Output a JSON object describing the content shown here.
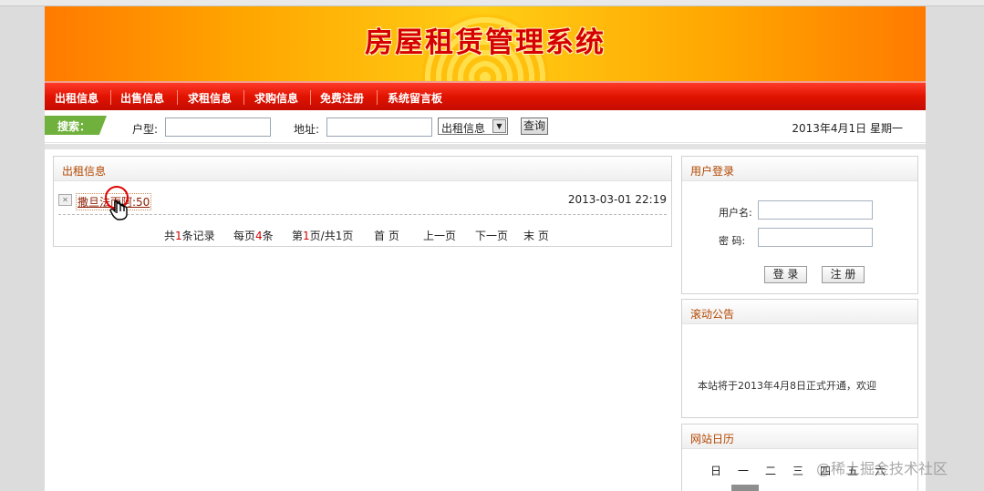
{
  "header": {
    "site_title": "房屋租赁管理系统"
  },
  "nav": {
    "items": [
      "出租信息",
      "出售信息",
      "求租信息",
      "求购信息",
      "免费注册",
      "系统留言板"
    ]
  },
  "search": {
    "tag": "搜索：",
    "type_label": "户型:",
    "type_value": "",
    "address_label": "地址:",
    "address_value": "",
    "category_selected": "出租信息",
    "query_button": "查询",
    "date": "2013年4月1日 星期一"
  },
  "listing": {
    "title": "出租信息",
    "rows": [
      {
        "label": "撒旦法而阿:50",
        "time": "2013-03-01 22:19"
      }
    ],
    "pager": {
      "total_prefix": "共",
      "total": "1",
      "total_suffix": "条记录",
      "per_page_prefix": "每页",
      "per_page": "4",
      "per_page_suffix": "条",
      "page_prefix": "第",
      "page": "1",
      "page_suffix": "页/共1页",
      "first": "首 页",
      "prev": "上一页",
      "next": "下一页",
      "last": "末 页"
    }
  },
  "login": {
    "title": "用户登录",
    "username_label": "用户名:",
    "password_label": "密 码:",
    "login_button": "登 录",
    "register_button": "注 册"
  },
  "notice": {
    "title": "滚动公告",
    "text": "本站将于2013年4月8日正式开通，欢迎"
  },
  "calendar": {
    "title": "网站日历",
    "weekdays": [
      "日",
      "一",
      "二",
      "三",
      "四",
      "五",
      "六"
    ]
  },
  "watermark": "@稀土掘金技术社区",
  "colors": {
    "nav_red": "#e11300",
    "heading_orange": "#b34700",
    "search_tag_green": "#6fb13c",
    "title_red": "#d60000"
  }
}
